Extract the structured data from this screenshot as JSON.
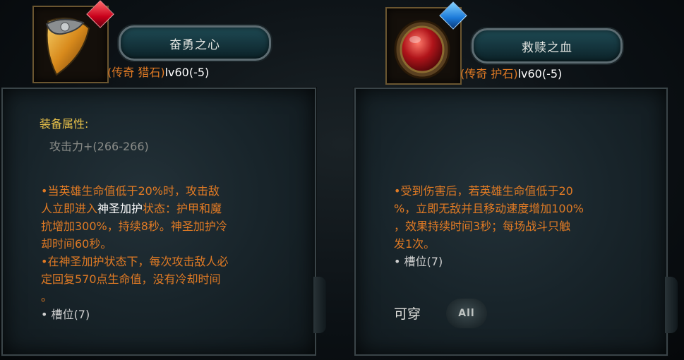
{
  "left": {
    "title": "奋勇之心",
    "rarity_type": "(传奇 猎石)",
    "level": "lv60(-5)",
    "attr_title": "装备属性:",
    "attr_label": "攻击力",
    "attr_value": "+(266-266)",
    "desc_lines": [
      "•当英雄生命值低于20%时，攻击敌",
      "人立即进入",
      "神圣加护",
      "状态：护甲和魔",
      "抗增加300%，持续8秒。神圣加护冷",
      "却时间60秒。",
      "•在神圣加护状态下，每次攻击敌人必",
      "定回复570点生命值，没有冷却时间",
      "。"
    ],
    "slot": "• 槽位(7)",
    "gem_color": "#c8001b"
  },
  "right": {
    "title": "救赎之血",
    "rarity_type": "(传奇 护石)",
    "level": "lv60(-5)",
    "desc_lines": [
      "•受到伤害后，若英雄生命值低于20",
      "%，立即无敌并且移动速度增加100%",
      "，效果持续时间3秒；每场战斗只触",
      "发1次。"
    ],
    "slot": "• 槽位(7)",
    "wearable": "可穿",
    "all_badge": "All",
    "gem_color": "#1a78d8"
  }
}
